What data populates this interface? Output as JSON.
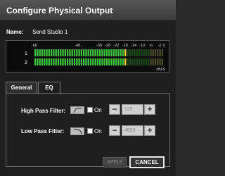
{
  "dialog": {
    "title": "Configure Physical Output",
    "name_label": "Name:",
    "name_value": "Send Studio 1"
  },
  "meter": {
    "scale_ticks": [
      "-60",
      "-40",
      "-30",
      "-26",
      "-22",
      "-18",
      "-14",
      "-10",
      "-6",
      "-2",
      "0"
    ],
    "channels": [
      {
        "label": "1",
        "level_db": -18
      },
      {
        "label": "2",
        "level_db": -18
      }
    ],
    "unit": "dBFS",
    "colors": {
      "active": "#3fc23f",
      "inactive": "#1f4a1f",
      "peak": "#f3d23a",
      "headroom": "#4a4a2a"
    }
  },
  "tabs": [
    {
      "label": "General",
      "selected": false
    },
    {
      "label": "EQ",
      "selected": true
    }
  ],
  "eq": {
    "high_pass": {
      "label": "High Pass Filter:",
      "mode_icon": "high-pass-icon",
      "on_label": "On",
      "checked": false,
      "value": "125",
      "minus": "−",
      "plus": "+"
    },
    "low_pass": {
      "label": "Low Pass Filter:",
      "mode_icon": "low-pass-icon",
      "on_label": "On",
      "checked": false,
      "value": "4000",
      "minus": "−",
      "plus": "+"
    }
  },
  "buttons": {
    "apply": "APPLY",
    "cancel": "CANCEL"
  }
}
